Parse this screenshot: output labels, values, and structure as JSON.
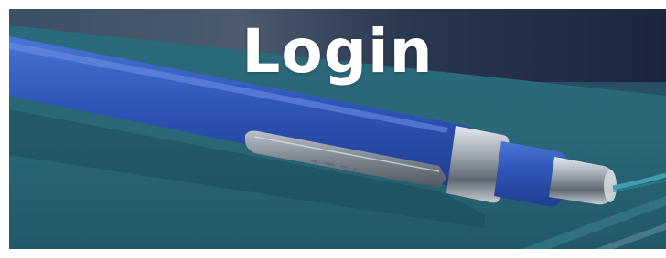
{
  "banner": {
    "title": "Login",
    "image_subject": "blue-pen-on-notebook",
    "colors": {
      "title_text": "#ffffff",
      "pen_blue": "#2f55b8",
      "notebook_teal": "#2a6676"
    }
  }
}
